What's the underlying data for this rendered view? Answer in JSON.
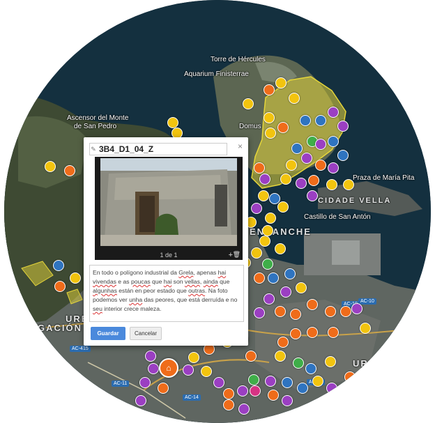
{
  "map": {
    "labels": {
      "torre": "Torre de Hércules",
      "aquarium": "Aquarium Finisterrae",
      "ascensor_1": "Ascensor del Monte",
      "ascensor_2": "de San Pedro",
      "domus": "Domus",
      "praza": "Praza de María Pita",
      "cidade_vella": "CIDADE VELLA",
      "castillo": "Castillo de San Antón",
      "ensanche": "ENSANCHE",
      "urb_left": "URB",
      "poligono": "GACIÓN CON",
      "urb_right": "URB"
    },
    "road_shields": [
      "AC-10",
      "AC-10",
      "AC-415",
      "AC-11",
      "AC-14",
      "AC-14"
    ],
    "colors": {
      "yellow": "#f2c40f",
      "orange": "#ef6c1a",
      "purple": "#9b3fc2",
      "blue": "#2f74c0",
      "green": "#3fae49",
      "pink": "#d63384",
      "area_fill": "#e6d63a"
    }
  },
  "popup": {
    "title": "3B4_D1_04_Z",
    "title_icon": "edit-icon",
    "close": "×",
    "photo_counter": "1 de 1",
    "add_photo": "+",
    "delete_photo": "trash-icon",
    "description_parts": [
      {
        "t": "En todo o polígono industrial da "
      },
      {
        "t": "Grela",
        "u": true
      },
      {
        "t": ", apenas "
      },
      {
        "t": "hai",
        "u": true
      },
      {
        "t": " "
      },
      {
        "t": "vivendas",
        "u": true
      },
      {
        "t": " e as "
      },
      {
        "t": "poucas",
        "u": true
      },
      {
        "t": " que "
      },
      {
        "t": "hai",
        "u": true
      },
      {
        "t": " son "
      },
      {
        "t": "vellas",
        "u": true
      },
      {
        "t": ", "
      },
      {
        "t": "ainda",
        "u": true
      },
      {
        "t": " que "
      },
      {
        "t": "algunhas",
        "u": true
      },
      {
        "t": " están en peor estado que "
      },
      {
        "t": "outras",
        "u": true
      },
      {
        "t": ". Na foto podemos ver "
      },
      {
        "t": "unha",
        "u": true
      },
      {
        "t": " das peores, que está derruída e no "
      },
      {
        "t": "seu",
        "u": true
      },
      {
        "t": " interior crece maleza."
      }
    ],
    "save_label": "Guardar",
    "cancel_label": "Cancelar"
  }
}
